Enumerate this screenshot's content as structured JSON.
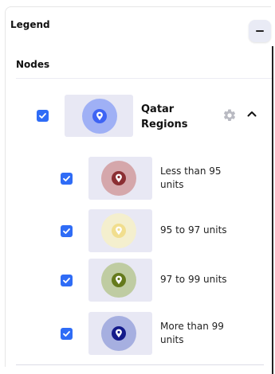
{
  "legend": {
    "title": "Legend",
    "collapse_label": "−"
  },
  "nodes": {
    "title": "Nodes",
    "group": {
      "label": "Qatar Regions",
      "checked": true,
      "halo_color": "#9fb0f5",
      "pin_color": "#3d63f4"
    },
    "items": [
      {
        "label": "Less than 95 units",
        "checked": true,
        "halo_color": "#d5a7ab",
        "pin_color": "#8b2e32"
      },
      {
        "label": "95 to 97 units",
        "checked": true,
        "halo_color": "#f4efce",
        "pin_color": "#f1de8e"
      },
      {
        "label": "97 to 99 units",
        "checked": true,
        "halo_color": "#bfcca2",
        "pin_color": "#657a1c"
      },
      {
        "label": "More than 99 units",
        "checked": true,
        "halo_color": "#a6afe0",
        "pin_color": "#141b8b"
      }
    ]
  },
  "colors": {
    "checkbox": "#2f6cf6",
    "thumb_bg": "#e8e8f4"
  },
  "icons": {
    "checkbox": "checkmark-icon",
    "gear": "gear-icon",
    "chevron": "chevron-up-icon",
    "pin": "map-pin-icon"
  }
}
